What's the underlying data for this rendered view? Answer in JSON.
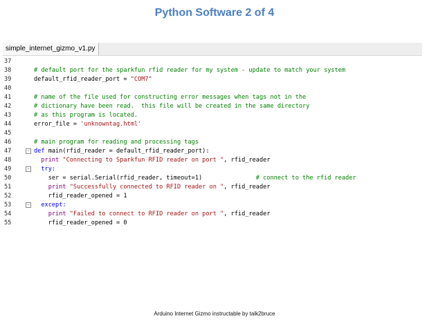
{
  "slide": {
    "title": "Python Software 2 of 4",
    "footer": "Arduino Internet  Gizmo instructable by talk2bruce"
  },
  "editor": {
    "tab_label": "simple_internet_gizmo_v1.py",
    "lines": [
      {
        "num": "37",
        "fold": "",
        "segments": []
      },
      {
        "num": "38",
        "fold": "",
        "segments": [
          {
            "t": "# default port for the sparkfun rfid reader for my system - update to match your system",
            "c": "c"
          }
        ]
      },
      {
        "num": "39",
        "fold": "",
        "segments": [
          {
            "t": "default_rfid_reader_port = ",
            "c": ""
          },
          {
            "t": "\"COM7\"",
            "c": "s"
          }
        ]
      },
      {
        "num": "40",
        "fold": "",
        "segments": []
      },
      {
        "num": "41",
        "fold": "",
        "segments": [
          {
            "t": "# name of the file used for constructing error messages when tags not in the",
            "c": "c"
          }
        ]
      },
      {
        "num": "42",
        "fold": "",
        "segments": [
          {
            "t": "# dictionary have been read.  this file will be created in the same directory",
            "c": "c"
          }
        ]
      },
      {
        "num": "43",
        "fold": "",
        "segments": [
          {
            "t": "# as this program is located.",
            "c": "c"
          }
        ]
      },
      {
        "num": "44",
        "fold": "",
        "segments": [
          {
            "t": "error_file = ",
            "c": ""
          },
          {
            "t": "'unknowntag.html'",
            "c": "s"
          }
        ]
      },
      {
        "num": "45",
        "fold": "",
        "segments": []
      },
      {
        "num": "46",
        "fold": "",
        "segments": [
          {
            "t": "# main program for reading and processing tags",
            "c": "c"
          }
        ]
      },
      {
        "num": "47",
        "fold": "box",
        "segments": [
          {
            "t": "def ",
            "c": "k"
          },
          {
            "t": "main(rfid_reader = default_rfid_reader_port):",
            "c": ""
          }
        ]
      },
      {
        "num": "48",
        "fold": "",
        "segments": [
          {
            "t": "  ",
            "c": ""
          },
          {
            "t": "print ",
            "c": "p"
          },
          {
            "t": "\"Connecting to Sparkfun RFID reader on port \"",
            "c": "s"
          },
          {
            "t": ", rfid_reader",
            "c": ""
          }
        ]
      },
      {
        "num": "49",
        "fold": "box",
        "segments": [
          {
            "t": "  ",
            "c": ""
          },
          {
            "t": "try:",
            "c": "k"
          }
        ]
      },
      {
        "num": "50",
        "fold": "",
        "segments": [
          {
            "t": "    ser = serial.Serial(rfid_reader, timeout=1)               ",
            "c": ""
          },
          {
            "t": "# connect to the rfid reader",
            "c": "c"
          }
        ]
      },
      {
        "num": "51",
        "fold": "",
        "segments": [
          {
            "t": "    ",
            "c": ""
          },
          {
            "t": "print ",
            "c": "p"
          },
          {
            "t": "\"Successfully connected to RFID reader on \"",
            "c": "s"
          },
          {
            "t": ", rfid_reader",
            "c": ""
          }
        ]
      },
      {
        "num": "52",
        "fold": "",
        "segments": [
          {
            "t": "    rfid_reader_opened = 1",
            "c": ""
          }
        ]
      },
      {
        "num": "53",
        "fold": "box",
        "segments": [
          {
            "t": "  ",
            "c": ""
          },
          {
            "t": "except:",
            "c": "k"
          }
        ]
      },
      {
        "num": "54",
        "fold": "",
        "segments": [
          {
            "t": "    ",
            "c": ""
          },
          {
            "t": "print ",
            "c": "p"
          },
          {
            "t": "\"Failed to connect to RFID reader on port \"",
            "c": "s"
          },
          {
            "t": ", rfid_reader",
            "c": ""
          }
        ]
      },
      {
        "num": "55",
        "fold": "",
        "segments": [
          {
            "t": "    rfid_reader_opened = 0",
            "c": ""
          }
        ]
      }
    ]
  }
}
